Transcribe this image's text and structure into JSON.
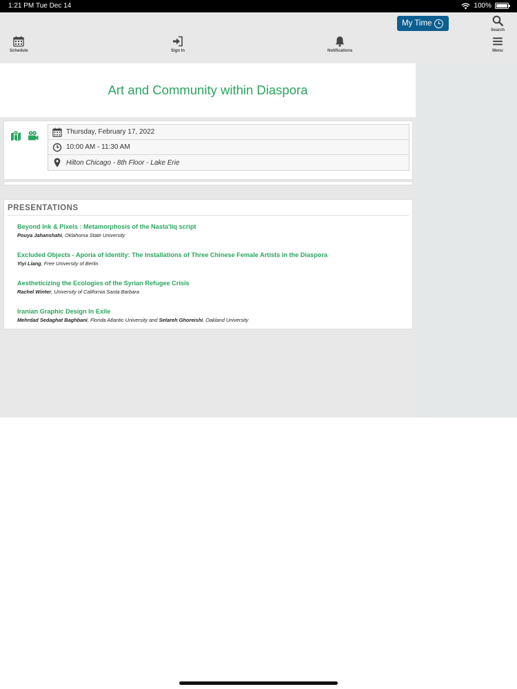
{
  "status_bar": {
    "time": "1:21 PM",
    "date": "Tue Dec 14",
    "battery": "100%",
    "wifi_icon": "wifi-icon"
  },
  "header": {
    "my_time_label": "My Time",
    "toolbar": {
      "schedule_label": "Schedule",
      "sign_in_label": "Sign In",
      "notifications_label": "Notifications",
      "search_label": "Search",
      "menu_label": "Menu"
    }
  },
  "session": {
    "title": "Art and Community within Diaspora",
    "date": "Thursday, February 17, 2022",
    "time": "10:00 AM - 11:30 AM",
    "location": "Hilton Chicago - 8th Floor - Lake Erie"
  },
  "presentations": {
    "heading": "PRESENTATIONS",
    "items": [
      {
        "title": "Beyond Ink & Pixels : Metamorphosis of the Nasta'liq script",
        "author1": "Pouya Jahanshahi",
        "affil1": ", Oklahoma State University"
      },
      {
        "title": "Excluded Objects - Aporia of Identity: The Installations of Three Chinese Female Artists in the Diaspora",
        "author1": "Yiyi Liang",
        "affil1": ", Free University of Berlin"
      },
      {
        "title": "Aestheticizing the Ecologies of the Syrian Refugee Crisis",
        "author1": "Rachel Winter",
        "affil1": ", University of California Santa Barbara"
      },
      {
        "title": "Iranian Graphic Design In Exile",
        "author1": "Mehrdad Sedaghat Baghbani",
        "affil1": ", Florida Atlantic University and ",
        "author2": "Setareh Ghoreishi",
        "affil2": ", Oakland University"
      }
    ]
  },
  "colors": {
    "accent_green": "#2aa55f",
    "my_time_blue": "#0d5f8f",
    "header_gray": "#e8e8e8"
  }
}
